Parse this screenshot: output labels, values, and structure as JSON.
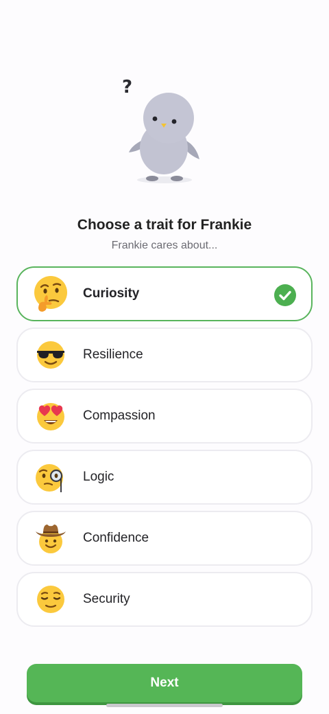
{
  "screen": {
    "title": "Choose a trait for Frankie",
    "subtitle": "Frankie cares about..."
  },
  "mascot": {
    "icon": "penguin-mascot-icon",
    "thought": "?"
  },
  "options": [
    {
      "label": "Curiosity",
      "icon": "thinking-face-icon",
      "selected": true
    },
    {
      "label": "Resilience",
      "icon": "sunglasses-face-icon",
      "selected": false
    },
    {
      "label": "Compassion",
      "icon": "heart-eyes-face-icon",
      "selected": false
    },
    {
      "label": "Logic",
      "icon": "monocle-face-icon",
      "selected": false
    },
    {
      "label": "Confidence",
      "icon": "cowboy-face-icon",
      "selected": false
    },
    {
      "label": "Security",
      "icon": "relieved-face-icon",
      "selected": false
    }
  ],
  "next_button": {
    "label": "Next"
  },
  "colors": {
    "accent": "#55b656",
    "selected_border": "#58b45c",
    "emoji_yellow": "#fbc93d"
  }
}
